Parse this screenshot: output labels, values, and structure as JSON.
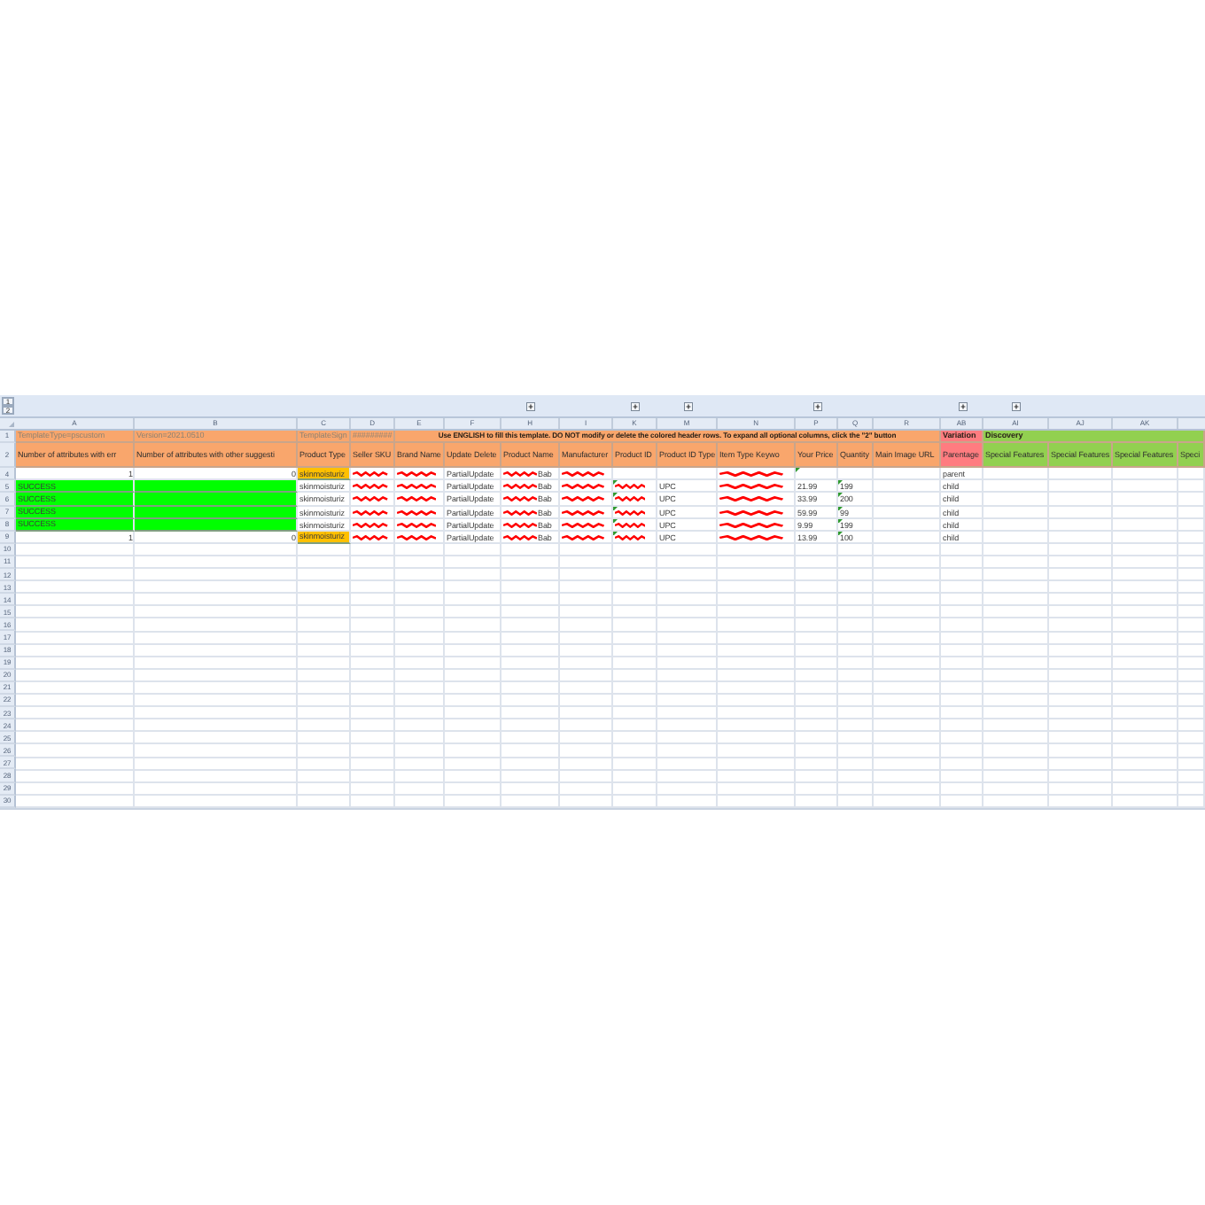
{
  "outline_bar": {
    "levels": [
      "1",
      "2"
    ]
  },
  "columns": [
    {
      "label": "A",
      "outline_button": false
    },
    {
      "label": "B",
      "outline_button": false
    },
    {
      "label": "C",
      "outline_button": false
    },
    {
      "label": "D",
      "outline_button": false
    },
    {
      "label": "E",
      "outline_button": false
    },
    {
      "label": "F",
      "outline_button": false
    },
    {
      "label": "H",
      "outline_button": true
    },
    {
      "label": "I",
      "outline_button": false
    },
    {
      "label": "K",
      "outline_button": true
    },
    {
      "label": "M",
      "outline_button": true
    },
    {
      "label": "N",
      "outline_button": false
    },
    {
      "label": "P",
      "outline_button": true
    },
    {
      "label": "Q",
      "outline_button": false
    },
    {
      "label": "R",
      "outline_button": false
    },
    {
      "label": "AB",
      "outline_button": true
    },
    {
      "label": "AI",
      "outline_button": true
    },
    {
      "label": "AJ",
      "outline_button": false
    },
    {
      "label": "AK",
      "outline_button": false
    },
    {
      "outline_button": false
    }
  ],
  "rows": [
    {
      "number": "1",
      "kind": "banner",
      "cells": [
        {
          "kind": "meta",
          "text": "TemplateType=pscustom",
          "color": "#f9a66c"
        },
        {
          "kind": "meta",
          "text": "Version=2021.0510",
          "color": "#f9a66c"
        },
        {
          "kind": "meta",
          "text": "TemplateSign",
          "color": "#f9a66c"
        },
        {
          "kind": "meta",
          "text": "#########",
          "color": "#f9a66c"
        },
        {
          "kind": "notice",
          "text": "Use ENGLISH to fill this template. DO NOT modify or delete the colored header rows. To expand all optional columns, click the \"2\" button",
          "color": "#f9a66c"
        },
        {
          "kind": "group",
          "text": "Variation",
          "color": "#ff7c80"
        },
        {
          "kind": "group",
          "text": "Discovery",
          "color": "#92d050"
        }
      ]
    },
    {
      "number": "2",
      "kind": "labels",
      "cells": [
        {
          "text": "Number of attributes with err",
          "color": "#f9a66c"
        },
        {
          "text": "Number of attributes with other suggesti",
          "color": "#f9a66c"
        },
        {
          "text": "Product Type",
          "color": "#f9a66c"
        },
        {
          "text": "Seller SKU",
          "color": "#f9a66c"
        },
        {
          "text": "Brand Name",
          "color": "#f9a66c"
        },
        {
          "text": "Update Delete",
          "color": "#f9a66c"
        },
        {
          "text": "Product Name",
          "color": "#f9a66c"
        },
        {
          "text": "Manufacturer",
          "color": "#f9a66c"
        },
        {
          "text": "Product ID",
          "color": "#f9a66c"
        },
        {
          "text": "Product ID Type",
          "color": "#f9a66c"
        },
        {
          "text": "Item Type Keywo",
          "color": "#f9a66c"
        },
        {
          "text": "Your Price",
          "color": "#f9a66c"
        },
        {
          "text": "Quantity",
          "color": "#f9a66c"
        },
        {
          "text": "Main Image URL",
          "color": "#f9a66c"
        },
        {
          "text": "Parentage",
          "color": "#ff7c80"
        },
        {
          "text": "Special Features",
          "color": "#92d050"
        },
        {
          "text": "Special Features",
          "color": "#92d050"
        },
        {
          "text": "Special Features",
          "color": "#92d050"
        },
        {
          "text": "Speci",
          "color": "#92d050"
        }
      ]
    },
    {
      "number": "4",
      "kind": "data",
      "cells": [
        {
          "kind": "number",
          "text": "1"
        },
        {
          "kind": "number",
          "text": "0"
        },
        {
          "kind": "text",
          "text": "skinmoisturiz",
          "color": "#ffc000"
        },
        {
          "kind": "redacted"
        },
        {
          "kind": "redacted"
        },
        {
          "kind": "text",
          "text": "PartialUpdate"
        },
        {
          "kind": "redacted",
          "text": "Bab"
        },
        {
          "kind": "redacted"
        },
        null,
        null,
        {
          "kind": "redacted"
        },
        {
          "kind": "flagged"
        },
        null,
        null,
        {
          "kind": "text",
          "text": "parent"
        },
        null,
        null,
        null,
        null
      ]
    },
    {
      "number": "5",
      "kind": "data",
      "cells": [
        {
          "kind": "text",
          "text": "SUCCESS",
          "color": "#00ff00"
        },
        {
          "kind": "fill",
          "color": "#00ff00"
        },
        {
          "kind": "text",
          "text": "skinmoisturiz"
        },
        {
          "kind": "redacted"
        },
        {
          "kind": "redacted"
        },
        {
          "kind": "text",
          "text": "PartialUpdate"
        },
        {
          "kind": "redacted",
          "text": "Bab"
        },
        {
          "kind": "redacted"
        },
        {
          "kind": "flagged-redacted"
        },
        {
          "kind": "text",
          "text": "UPC"
        },
        {
          "kind": "redacted"
        },
        {
          "kind": "text",
          "text": "21.99"
        },
        {
          "kind": "flagged",
          "text": "199"
        },
        null,
        {
          "kind": "text",
          "text": "child"
        },
        null,
        null,
        null,
        null
      ]
    },
    {
      "number": "6",
      "kind": "data",
      "cells": [
        {
          "kind": "text",
          "text": "SUCCESS",
          "color": "#00ff00"
        },
        {
          "kind": "fill",
          "color": "#00ff00"
        },
        {
          "kind": "text",
          "text": "skinmoisturiz"
        },
        {
          "kind": "redacted"
        },
        {
          "kind": "redacted"
        },
        {
          "kind": "text",
          "text": "PartialUpdate"
        },
        {
          "kind": "redacted",
          "text": "Bab"
        },
        {
          "kind": "redacted"
        },
        {
          "kind": "flagged-redacted"
        },
        {
          "kind": "text",
          "text": "UPC"
        },
        {
          "kind": "redacted"
        },
        {
          "kind": "text",
          "text": "33.99"
        },
        {
          "kind": "flagged",
          "text": "200"
        },
        null,
        {
          "kind": "text",
          "text": "child"
        },
        null,
        null,
        null,
        null
      ]
    },
    {
      "number": "7",
      "kind": "data",
      "cells": [
        {
          "kind": "text",
          "text": "SUCCESS",
          "color": "#00ff00"
        },
        {
          "kind": "fill",
          "color": "#00ff00"
        },
        {
          "kind": "text",
          "text": "skinmoisturiz"
        },
        {
          "kind": "redacted"
        },
        {
          "kind": "redacted"
        },
        {
          "kind": "text",
          "text": "PartialUpdate"
        },
        {
          "kind": "redacted",
          "text": "Bab"
        },
        {
          "kind": "redacted"
        },
        {
          "kind": "flagged-redacted"
        },
        {
          "kind": "text",
          "text": "UPC"
        },
        {
          "kind": "redacted"
        },
        {
          "kind": "text",
          "text": "59.99"
        },
        {
          "kind": "flagged",
          "text": "99"
        },
        null,
        {
          "kind": "text",
          "text": "child"
        },
        null,
        null,
        null,
        null
      ]
    },
    {
      "number": "8",
      "kind": "data",
      "cells": [
        {
          "kind": "text",
          "text": "SUCCESS",
          "color": "#00ff00"
        },
        {
          "kind": "fill",
          "color": "#00ff00"
        },
        {
          "kind": "text",
          "text": "skinmoisturiz"
        },
        {
          "kind": "redacted"
        },
        {
          "kind": "redacted"
        },
        {
          "kind": "text",
          "text": "PartialUpdate"
        },
        {
          "kind": "redacted",
          "text": "Bab"
        },
        {
          "kind": "redacted"
        },
        {
          "kind": "flagged-redacted"
        },
        {
          "kind": "text",
          "text": "UPC"
        },
        {
          "kind": "redacted"
        },
        {
          "kind": "text",
          "text": "9.99"
        },
        {
          "kind": "flagged",
          "text": "199"
        },
        null,
        {
          "kind": "text",
          "text": "child"
        },
        null,
        null,
        null,
        null
      ]
    },
    {
      "number": "9",
      "kind": "data",
      "cells": [
        {
          "kind": "number",
          "text": "1"
        },
        {
          "kind": "number",
          "text": "0"
        },
        {
          "kind": "text",
          "text": "skinmoisturiz",
          "color": "#ffc000"
        },
        {
          "kind": "redacted"
        },
        {
          "kind": "redacted"
        },
        {
          "kind": "text",
          "text": "PartialUpdate"
        },
        {
          "kind": "redacted",
          "text": "Bab"
        },
        {
          "kind": "redacted"
        },
        {
          "kind": "flagged-redacted"
        },
        {
          "kind": "text",
          "text": "UPC"
        },
        {
          "kind": "redacted"
        },
        {
          "kind": "text",
          "text": "13.99"
        },
        {
          "kind": "flagged",
          "text": "100"
        },
        null,
        {
          "kind": "text",
          "text": "child"
        },
        null,
        null,
        null,
        null
      ]
    },
    {
      "number": "10",
      "kind": "data"
    },
    {
      "number": "11",
      "kind": "data"
    },
    {
      "number": "12",
      "kind": "data"
    },
    {
      "number": "13",
      "kind": "data"
    },
    {
      "number": "14",
      "kind": "data"
    },
    {
      "number": "15",
      "kind": "data"
    },
    {
      "number": "16",
      "kind": "data"
    },
    {
      "number": "17",
      "kind": "data"
    },
    {
      "number": "18",
      "kind": "data"
    },
    {
      "number": "19",
      "kind": "data"
    },
    {
      "number": "20",
      "kind": "data"
    },
    {
      "number": "21",
      "kind": "data"
    },
    {
      "number": "22",
      "kind": "data"
    },
    {
      "number": "23",
      "kind": "data"
    },
    {
      "number": "24",
      "kind": "data"
    },
    {
      "number": "25",
      "kind": "data"
    },
    {
      "number": "26",
      "kind": "data"
    },
    {
      "number": "27",
      "kind": "data"
    },
    {
      "number": "28",
      "kind": "data"
    },
    {
      "number": "29",
      "kind": "data"
    },
    {
      "number": "30",
      "kind": "data"
    }
  ]
}
